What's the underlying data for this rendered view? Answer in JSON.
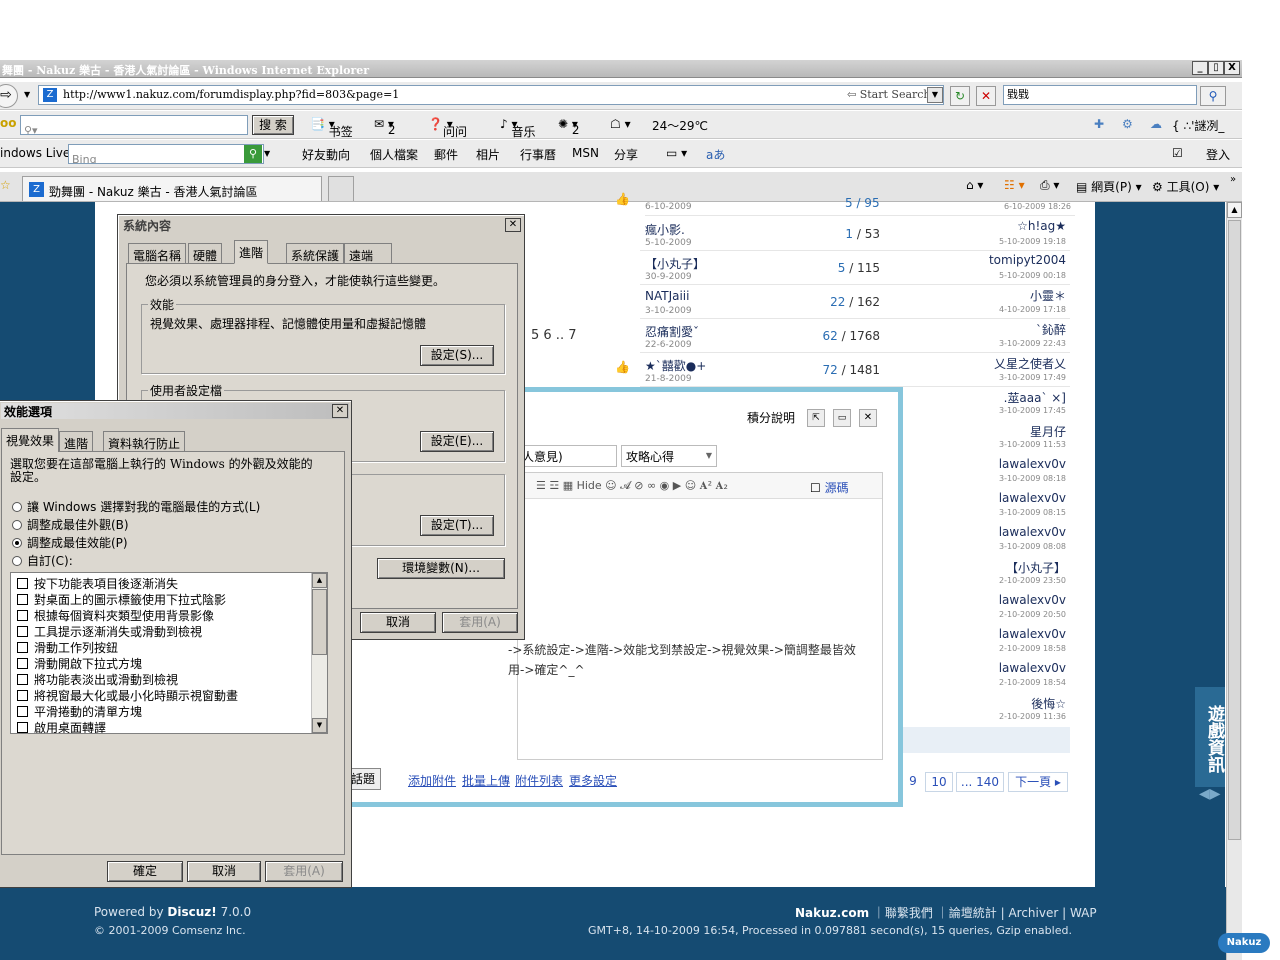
{
  "window": {
    "title": "舞團 - Nakuz 樂古 - 香港人氣討論區 - Windows Internet Explorer",
    "min": "_",
    "max": "▯",
    "close": "X"
  },
  "address": {
    "url": "http://www1.nakuz.com/forumdisplay.php?fid=803&page=1",
    "start_search": "Start Search",
    "search_value": "戥戥"
  },
  "yahoo_bar": {
    "logo": "oo",
    "search_btn": "搜 索",
    "bookmarks": "书签",
    "mail": "2",
    "ask": "问问",
    "music": "音乐",
    "horoscope": "2",
    "weather": "24～29℃",
    "right": "{ ∴'謎冽_"
  },
  "live_bar": {
    "label": "indows Live",
    "bing": "Bing",
    "items": [
      "好友動向",
      "個人檔案",
      "郵件",
      "相片",
      "行事曆",
      "MSN",
      "分享"
    ],
    "signin": "登入"
  },
  "tabs": {
    "active": "勁舞團 - Nakuz 樂古 - 香港人氣討論區",
    "page_menu": "網頁(P)",
    "tools_menu": "工具(O)"
  },
  "forum": {
    "rows": [
      {
        "author": "瘋小影.",
        "adate": "5-10-2009",
        "replies": "1",
        "views": "53",
        "last": "☆h!ag★",
        "ldate": "5-10-2009 19:18"
      },
      {
        "author": "【小丸子】",
        "adate": "30-9-2009",
        "replies": "5",
        "views": "115",
        "last": "tomipyt2004",
        "ldate": "5-10-2009 00:18"
      },
      {
        "author": "NATJaiii",
        "adate": "3-10-2009",
        "replies": "22",
        "views": "162",
        "last": "小靈＊",
        "ldate": "4-10-2009 17:18"
      },
      {
        "author": "忍痛割愛ˇ",
        "adate": "22-6-2009",
        "replies": "62",
        "views": "1768",
        "last": "`鈊醉",
        "ldate": "3-10-2009 22:43"
      },
      {
        "author": "★`囍歡●+",
        "adate": "21-8-2009",
        "replies": "72",
        "views": "1481",
        "last": "乂星之使者乂",
        "ldate": "3-10-2009 17:49"
      }
    ],
    "right_only": [
      {
        "last": ".莁aaa` ×]",
        "ldate": "3-10-2009 17:45"
      },
      {
        "last": "星月仔",
        "ldate": "3-10-2009 11:53"
      },
      {
        "last": "lawalexv0v",
        "ldate": "3-10-2009 08:18"
      },
      {
        "last": "lawalexv0v",
        "ldate": "3-10-2009 08:15"
      },
      {
        "last": "lawalexv0v",
        "ldate": "3-10-2009 08:08"
      },
      {
        "last": "【小丸子】",
        "ldate": "2-10-2009 23:50"
      },
      {
        "last": "lawalexv0v",
        "ldate": "2-10-2009 20:50"
      },
      {
        "last": "lawalexv0v",
        "ldate": "2-10-2009 18:58"
      },
      {
        "last": "lawalexv0v",
        "ldate": "2-10-2009 18:54"
      },
      {
        "last": "後悔☆",
        "ldate": "2-10-2009 11:36"
      }
    ],
    "top_partial_date": "6-10-2009",
    "top_partial_ldate": "6-10-2009 18:26",
    "top_partial_count": "5 / 95",
    "pages_inline": "5 6 .. 7",
    "pager": [
      "9",
      "10",
      "... 140"
    ],
    "next": "下一頁"
  },
  "editor": {
    "points_help": "積分說明",
    "subject_tail": "人意見)",
    "category": "攻略心得",
    "source": "源碼",
    "content_line1": "->系統設定->進階->效能戈到禁設定->視覺效果->簡調整最皆效",
    "content_line2": "用->確定^_^",
    "post_btn": "話題",
    "links": [
      "添加附件",
      "批量上傳",
      "附件列表",
      "更多設定"
    ]
  },
  "sysprops": {
    "title": "系統內容",
    "tabs": [
      "電腦名稱",
      "硬體",
      "進階",
      "系統保護",
      "遠端"
    ],
    "admin_note": "您必須以系統管理員的身分登入，才能使執行這些變更。",
    "perf_group": "效能",
    "perf_desc": "視覺效果、處理器排程、記憶體使用量和虛擬記憶體",
    "settings_s": "設定(S)...",
    "profile_group": "使用者設定檔",
    "settings_e": "設定(E)...",
    "settings_t": "設定(T)...",
    "env_btn": "環境變數(N)...",
    "cancel": "取消",
    "apply": "套用(A)"
  },
  "perfopts": {
    "title": "效能選項",
    "tabs": [
      "視覺效果",
      "進階",
      "資料執行防止"
    ],
    "intro": "選取您要在這部電腦上執行的 Windows 的外觀及效能的設定。",
    "options": [
      "讓 Windows 選擇對我的電腦最佳的方式(L)",
      "調整成最佳外觀(B)",
      "調整成最佳效能(P)",
      "自訂(C):"
    ],
    "checks": [
      "按下功能表項目後逐漸消失",
      "對桌面上的圖示標籤使用下拉式陰影",
      "根據每個資料夾類型使用背景影像",
      "工具提示逐漸消失或滑動到檢視",
      "滑動工作列按鈕",
      "滑動開啟下拉式方塊",
      "將功能表淡出或滑動到檢視",
      "將視窗最大化或最小化時顯示視窗動畫",
      "平滑捲動的清單方塊",
      "啟用桌面轉譯"
    ],
    "ok": "確定",
    "cancel": "取消",
    "apply": "套用(A)"
  },
  "footer": {
    "powered": "Powered by",
    "discuz": "Discuz!",
    "ver": "7.0.0",
    "copy": "© 2001-2009 Comsenz Inc.",
    "site": "Nakuz.com",
    "links": [
      "聯繫我們",
      "論壇統計",
      "Archiver",
      "WAP"
    ],
    "info": "GMT+8, 14-10-2009 16:54, Processed in 0.097881 second(s), 15 queries, Gzip enabled.",
    "badge": "Nakuz"
  },
  "sidebar_label": "遊戲資訊"
}
